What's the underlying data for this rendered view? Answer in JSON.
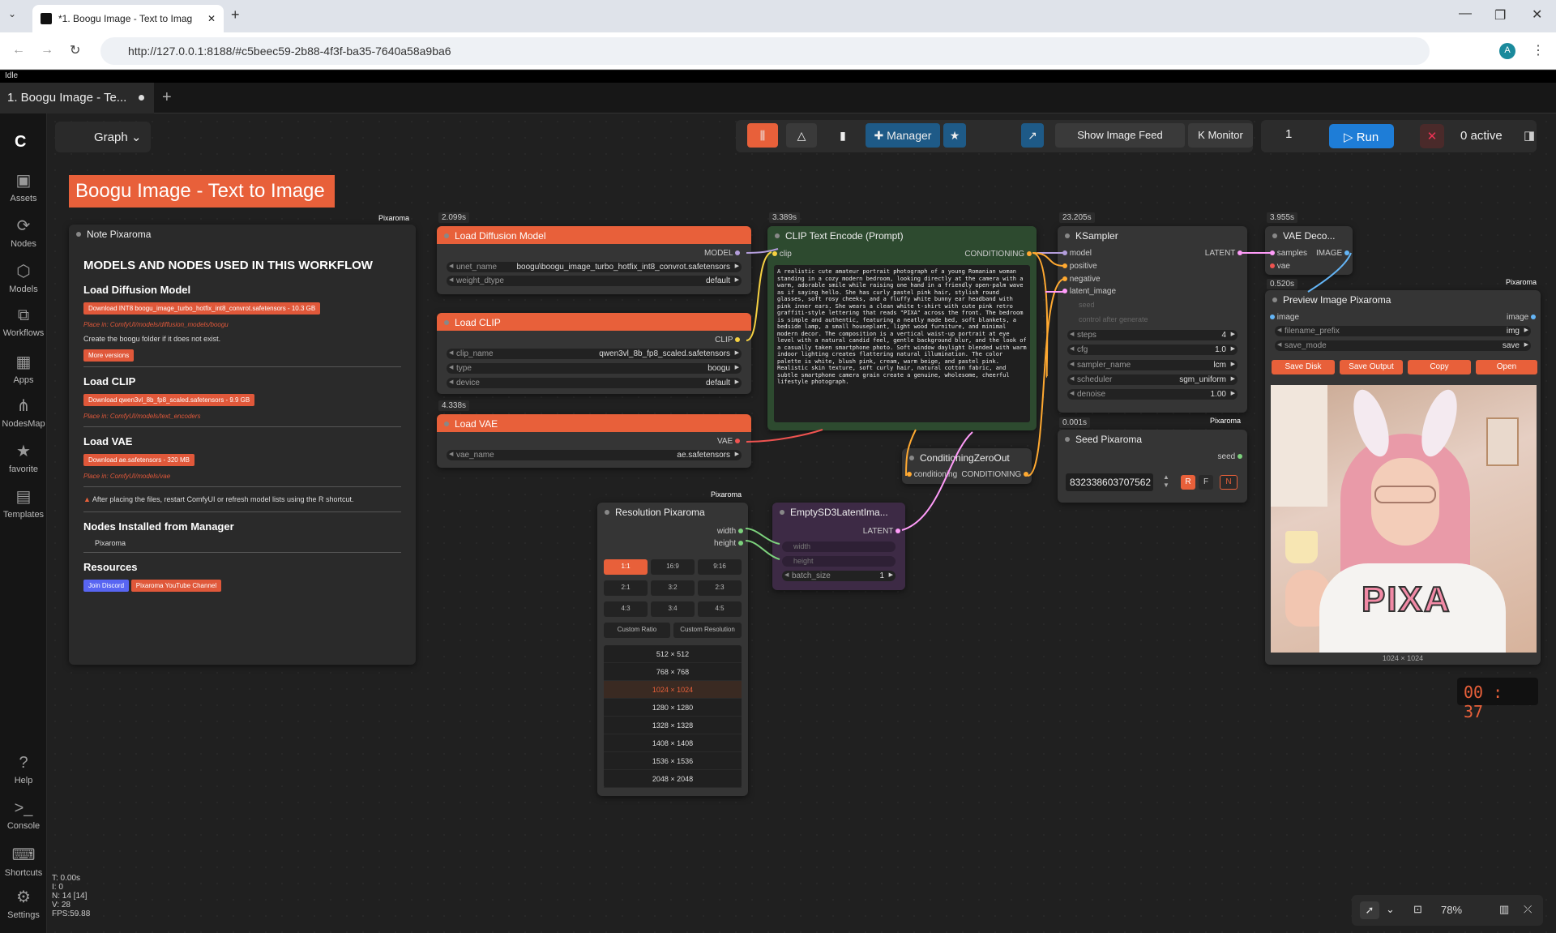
{
  "browser": {
    "tab_title": "*1. Boogu Image - Text to Imag",
    "url": "http://127.0.0.1:8188/#c5beec59-2b88-4f3f-ba35-7640a58a9ba6",
    "avatar": "A"
  },
  "status": "Idle",
  "workflow_tab": "1. Boogu Image - Te...",
  "graph_label": "Graph",
  "sidebar": [
    {
      "label": "Assets",
      "icon": "▣"
    },
    {
      "label": "Nodes",
      "icon": "⟳"
    },
    {
      "label": "Models",
      "icon": "⬡"
    },
    {
      "label": "Workflows",
      "icon": "⧉"
    },
    {
      "label": "Apps",
      "icon": "▦"
    },
    {
      "label": "NodesMap",
      "icon": "⋔"
    },
    {
      "label": "favorite",
      "icon": "★"
    },
    {
      "label": "Templates",
      "icon": "▤"
    }
  ],
  "sidebar_bottom": [
    {
      "label": "Help",
      "icon": "?"
    },
    {
      "label": "Console",
      "icon": ">_"
    },
    {
      "label": "Shortcuts",
      "icon": "⌨"
    },
    {
      "label": "Settings",
      "icon": "⚙"
    }
  ],
  "toolbar": {
    "manager": "Manager",
    "image_feed": "Show Image Feed",
    "monitor": "Monitor",
    "batch": "1",
    "run": "Run",
    "active": "0 active"
  },
  "title_banner": "Boogu Image - Text to Image",
  "note": {
    "header": "Note Pixaroma",
    "tag": "Pixaroma",
    "heading": "MODELS AND NODES USED IN THIS WORKFLOW",
    "load_diffusion": "Load Diffusion Model",
    "dl1": "Download INT8 boogu_image_turbo_hotfix_int8_convrot.safetensors - 10.3 GB",
    "place1": "Place in: ComfyUI/models/diffusion_models/boogu",
    "create": "Create the  boogu  folder if it does not exist.",
    "more": "More versions",
    "load_clip": "Load CLIP",
    "dl2": "Download qwen3vl_8b_fp8_scaled.safetensors - 9.9 GB",
    "place2": "Place in: ComfyUI/models/text_encoders",
    "load_vae": "Load VAE",
    "dl3": "Download ae.safetensors - 320 MB",
    "place3": "Place in: ComfyUI/models/vae",
    "warn": "After placing the files, restart ComfyUI or refresh model lists using the R shortcut.",
    "nodes_installed": "Nodes Installed from Manager",
    "pix": "Pixaroma",
    "resources": "Resources",
    "discord": "Join Discord",
    "youtube": "Pixaroma YouTube Channel"
  },
  "load_diffusion": {
    "time": "2.099s",
    "title": "Load Diffusion Model",
    "out": "MODEL",
    "unet_name": "unet_name",
    "unet_val": "boogu\\boogu_image_turbo_hotfix_int8_convrot.safetensors",
    "wd": "weight_dtype",
    "wd_val": "default"
  },
  "load_clip": {
    "title": "Load CLIP",
    "out": "CLIP",
    "clip_name": "clip_name",
    "clip_val": "qwen3vl_8b_fp8_scaled.safetensors",
    "type": "type",
    "type_val": "boogu",
    "device": "device",
    "device_val": "default"
  },
  "load_vae": {
    "time": "4.338s",
    "title": "Load VAE",
    "out": "VAE",
    "vae_name": "vae_name",
    "vae_val": "ae.safetensors"
  },
  "clip_text": {
    "time": "3.389s",
    "title": "CLIP Text Encode (Prompt)",
    "in": "clip",
    "out": "CONDITIONING",
    "prompt": "A realistic cute amateur portrait photograph of a young Romanian woman standing in a cozy modern bedroom, looking directly at the camera with a warm, adorable smile while raising one hand in a friendly open-palm wave as if saying hello. She has curly pastel pink hair, stylish round glasses, soft rosy cheeks, and a fluffy white bunny ear headband with pink inner ears. She wears a clean white t-shirt with cute pink retro graffiti-style lettering that reads \"PIXA\" across the front. The bedroom is simple and authentic, featuring a neatly made bed, soft blankets, a bedside lamp, a small houseplant, light wood furniture, and minimal modern decor. The composition is a vertical waist-up portrait at eye level with a natural candid feel, gentle background blur, and the look of a casually taken smartphone photo. Soft window daylight blended with warm indoor lighting creates flattering natural illumination. The color palette is white, blush pink, cream, warm beige, and pastel pink. Realistic skin texture, soft curly hair, natural cotton fabric, and subtle smartphone camera grain create a genuine, wholesome, cheerful lifestyle photograph."
  },
  "ksampler": {
    "time": "23.205s",
    "title": "KSampler",
    "out": "LATENT",
    "ins": [
      "model",
      "positive",
      "negative",
      "latent_image"
    ],
    "seed": "seed",
    "cag": "control after generate",
    "steps": "steps",
    "steps_val": "4",
    "cfg": "cfg",
    "cfg_val": "1.0",
    "sampler": "sampler_name",
    "sampler_val": "lcm",
    "scheduler": "scheduler",
    "scheduler_val": "sgm_uniform",
    "denoise": "denoise",
    "denoise_val": "1.00"
  },
  "vae_decode": {
    "time": "3.955s",
    "title": "VAE Deco...",
    "samples": "samples",
    "vae": "vae",
    "out": "IMAGE"
  },
  "preview": {
    "time": "0.520s",
    "tag": "Pixaroma",
    "title": "Preview Image Pixaroma",
    "in": "image",
    "out": "image",
    "fp": "filename_prefix",
    "fp_val": "img",
    "sm": "save_mode",
    "sm_val": "save",
    "btns": [
      "Save Disk",
      "Save Output",
      "Copy",
      "Open"
    ],
    "size": "1024 × 1024",
    "shirt": "PIXA"
  },
  "seed": {
    "time": "0.001s",
    "tag": "Pixaroma",
    "title": "Seed Pixaroma",
    "out": "seed",
    "value": "832338603707562",
    "r": "R",
    "f": "F",
    "n": "N"
  },
  "cond_zero": {
    "title": "ConditioningZeroOut",
    "in": "conditioning",
    "out": "CONDITIONING"
  },
  "resolution": {
    "tag": "Pixaroma",
    "title": "Resolution Pixaroma",
    "width": "width",
    "height": "height",
    "ratios": [
      "1:1",
      "16:9",
      "9:16",
      "2:1",
      "3:2",
      "2:3",
      "4:3",
      "3:4",
      "4:5"
    ],
    "custom_ratio": "Custom Ratio",
    "custom_res": "Custom Resolution",
    "sizes": [
      "512 × 512",
      "768 × 768",
      "1024 × 1024",
      "1280 × 1280",
      "1328 × 1328",
      "1408 × 1408",
      "1536 × 1536",
      "2048 × 2048"
    ]
  },
  "empty_latent": {
    "title": "EmptySD3LatentIma...",
    "out": "LATENT",
    "width": "width",
    "height": "height",
    "bs": "batch_size",
    "bs_val": "1"
  },
  "timer": "00 : 37",
  "stats": [
    "T: 0.00s",
    "I: 0",
    "N: 14 [14]",
    "V: 28",
    "FPS:59.88"
  ],
  "zoom": "78%"
}
